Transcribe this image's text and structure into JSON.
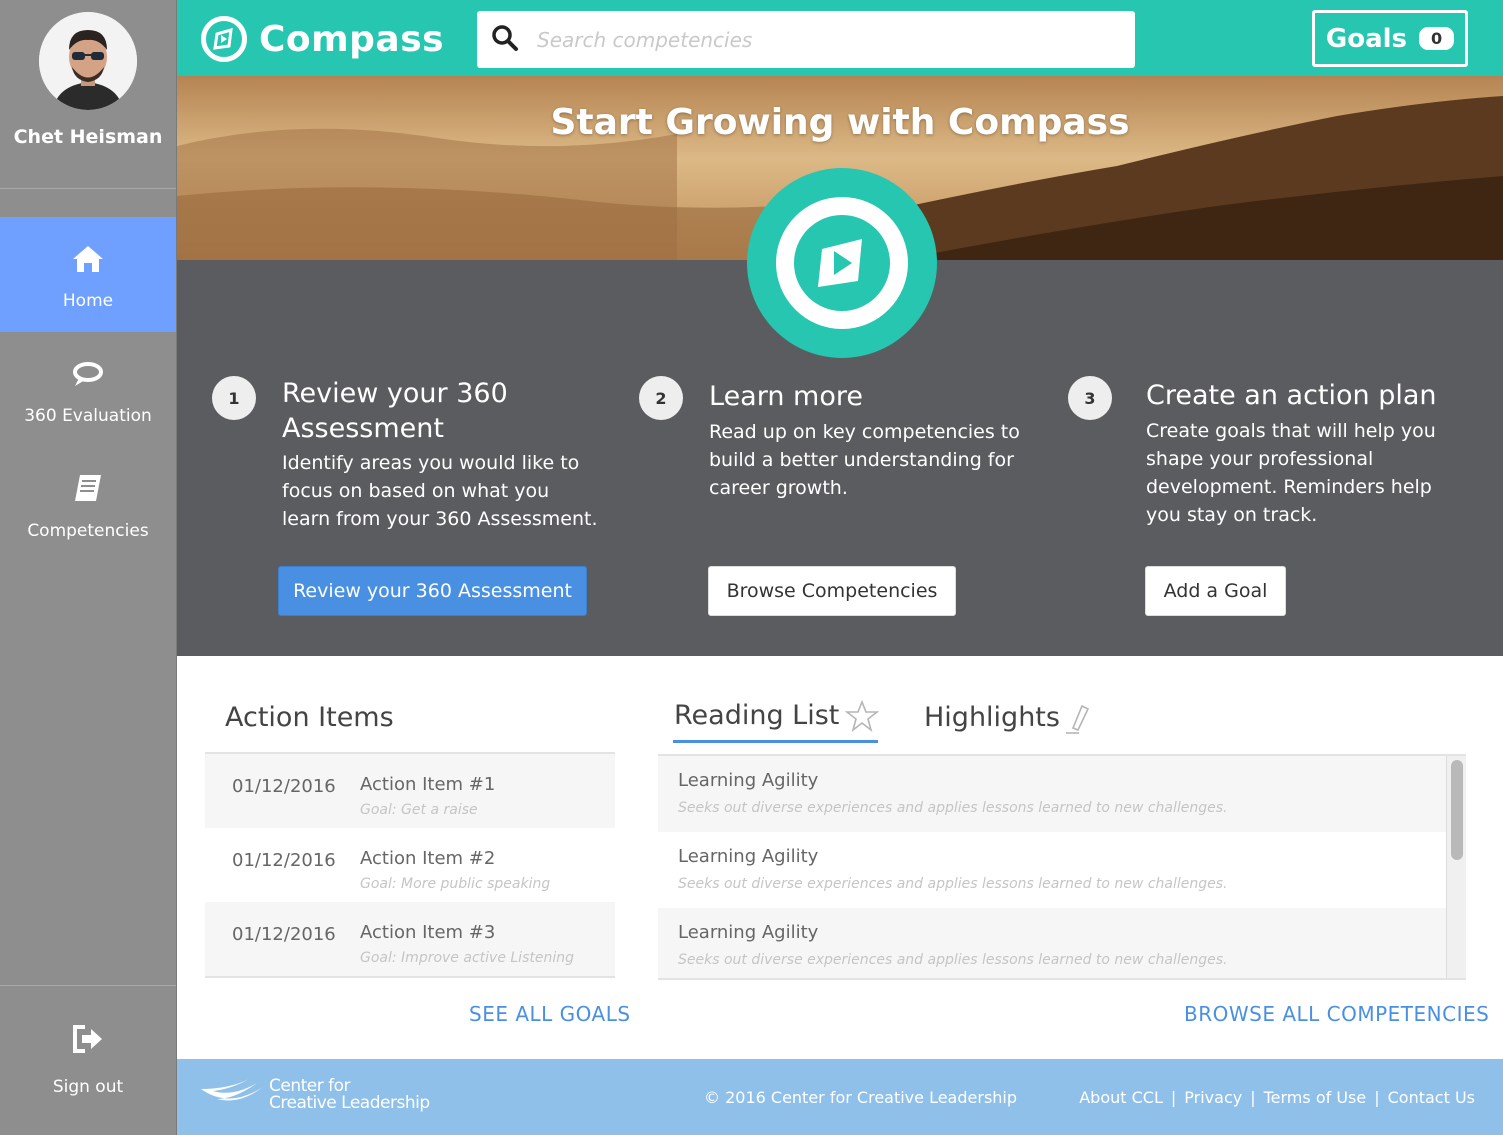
{
  "user": {
    "name": "Chet Heisman"
  },
  "sidebar": {
    "items": [
      {
        "label": "Home",
        "icon": "home-icon",
        "active": true
      },
      {
        "label": "360 Evaluation",
        "icon": "evaluation-icon",
        "active": false
      },
      {
        "label": "Competencies",
        "icon": "book-icon",
        "active": false
      }
    ],
    "signout_label": "Sign out"
  },
  "header": {
    "brand": "Compass",
    "search_placeholder": "Search competencies",
    "goals_label": "Goals",
    "goals_count": "0"
  },
  "hero": {
    "title": "Start Growing with Compass",
    "steps": [
      {
        "number": "1",
        "title_line1": "Review your 360",
        "title_line2": "Assessment",
        "desc_lines": [
          "Identify areas you would like to",
          "focus on based on what you",
          "learn from your 360 Assessment."
        ],
        "button": "Review your 360 Assessment"
      },
      {
        "number": "2",
        "title_line1": "Learn more",
        "desc_lines": [
          "Read up on key competencies to",
          "build a better understanding for",
          "career growth."
        ],
        "button": "Browse Competencies"
      },
      {
        "number": "3",
        "title_line1": "Create an action plan",
        "desc_lines": [
          "Create goals that will help you",
          "shape your professional",
          "development. Reminders help",
          "you stay on track."
        ],
        "button": "Add a Goal"
      }
    ]
  },
  "action_items": {
    "title": "Action Items",
    "rows": [
      {
        "date": "01/12/2016",
        "name": "Action Item #1",
        "goal": "Goal: Get a raise"
      },
      {
        "date": "01/12/2016",
        "name": "Action Item #2",
        "goal": "Goal: More public speaking"
      },
      {
        "date": "01/12/2016",
        "name": "Action Item #3",
        "goal": "Goal: Improve active Listening"
      }
    ],
    "link": "SEE ALL GOALS"
  },
  "reading": {
    "tabs": [
      "Reading List",
      "Highlights"
    ],
    "rows": [
      {
        "title": "Learning Agility",
        "desc": "Seeks out diverse experiences and applies lessons learned to new challenges."
      },
      {
        "title": "Learning Agility",
        "desc": "Seeks out diverse experiences and applies lessons learned to new challenges."
      },
      {
        "title": "Learning Agility",
        "desc": "Seeks out diverse experiences and applies lessons learned to new challenges."
      }
    ],
    "link": "BROWSE ALL COMPETENCIES"
  },
  "footer": {
    "logo_line1": "Center for",
    "logo_line2": "Creative Leadership",
    "copyright": "© 2016 Center for Creative Leadership",
    "links": [
      "About CCL",
      "Privacy",
      "Terms of Use",
      "Contact Us"
    ]
  },
  "colors": {
    "accent": "#26c6b0",
    "nav_active": "#6fa0ff",
    "primary_button": "#4a90e2",
    "hero_bg": "#5b5c5f",
    "sidebar_bg": "#8e8e8e",
    "footer_bg": "#8fc0ea"
  }
}
